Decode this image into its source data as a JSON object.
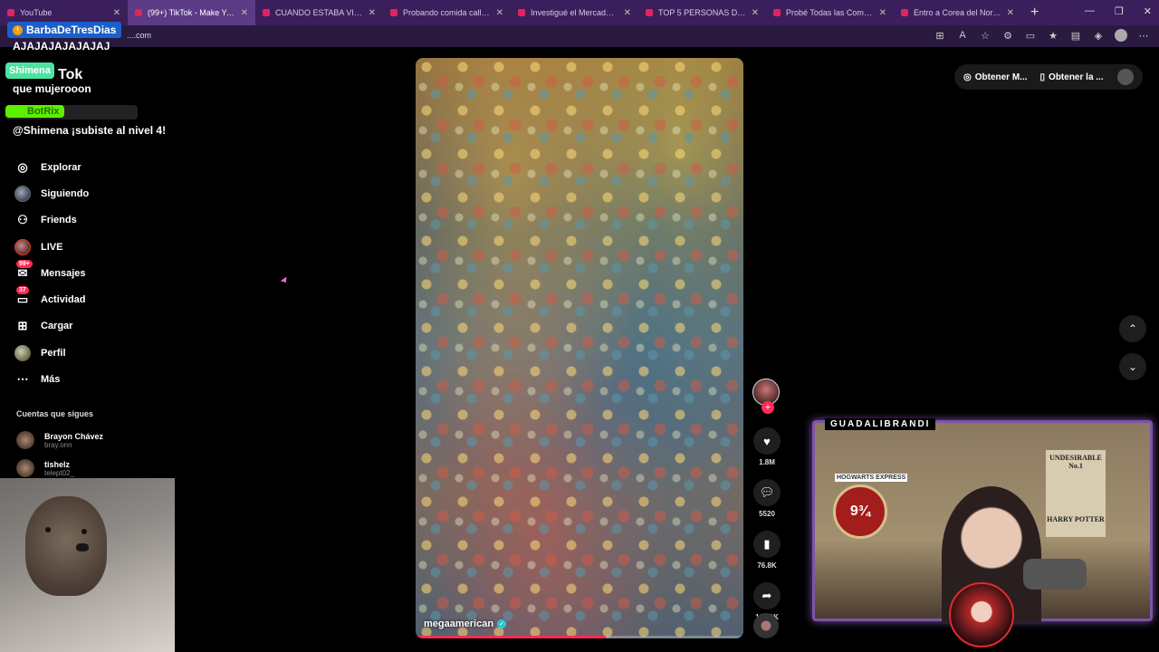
{
  "browser": {
    "tabs": [
      {
        "title": "YouTube",
        "active": false
      },
      {
        "title": "(99+) TikTok - Make Your",
        "active": true
      },
      {
        "title": "CUANDO ESTABA VIVA a NA",
        "active": false
      },
      {
        "title": "Probando comida callejera e",
        "active": false
      },
      {
        "title": "Investigué el Mercado de Ar",
        "active": false
      },
      {
        "title": "TOP 5 PERSONAS DESINFOR",
        "active": false
      },
      {
        "title": "Probé Todas las Comidas XX",
        "active": false
      },
      {
        "title": "Entro a Corea del Norte - Yo",
        "active": false
      }
    ],
    "url": "....com"
  },
  "chat": {
    "username": "BarbaDeTresDias",
    "msg1": "AJAJAJAJAJAJAJ",
    "tag_shimena": "Shimena",
    "logo_fragment": "Tok",
    "msg2": "que mujerooon",
    "tag_botrix": "BotRix",
    "msg3": "@Shimena ¡subiste al nivel 4!"
  },
  "nav": {
    "items": [
      {
        "label": "Explorar",
        "icon": "compass-icon"
      },
      {
        "label": "Siguiendo",
        "icon": "avatar-icon"
      },
      {
        "label": "Friends",
        "icon": "friends-icon"
      },
      {
        "label": "LIVE",
        "icon": "live-icon"
      },
      {
        "label": "Mensajes",
        "icon": "messages-icon",
        "badge": "99+"
      },
      {
        "label": "Actividad",
        "icon": "activity-icon",
        "badge": "37"
      },
      {
        "label": "Cargar",
        "icon": "upload-icon"
      },
      {
        "label": "Perfil",
        "icon": "profile-icon"
      },
      {
        "label": "Más",
        "icon": "more-icon"
      }
    ],
    "following_title": "Cuentas que sigues",
    "following": [
      {
        "name": "Brayon Chávez",
        "handle": "bray.onn"
      },
      {
        "name": "tishelz",
        "handle": "telept02_"
      }
    ]
  },
  "video": {
    "username": "megaamerican",
    "progress": 0.58
  },
  "actions": {
    "likes": "1.8M",
    "comments": "5520",
    "saves": "76.8K",
    "shares": "108.1K"
  },
  "topright": {
    "item1": "Obtener M...",
    "item2": "Obtener la ..."
  },
  "facecam": {
    "label": "GUADALIBRANDI",
    "platform": "9¾",
    "poster_title": "UNDESIRABLE No.1",
    "poster_name": "HARRY POTTER",
    "sign": "HOGWARTS EXPRESS"
  },
  "colors": {
    "accent": "#fe2c55",
    "facecam_border": "#7d54a8",
    "tabbar": "#3b1f5c"
  }
}
